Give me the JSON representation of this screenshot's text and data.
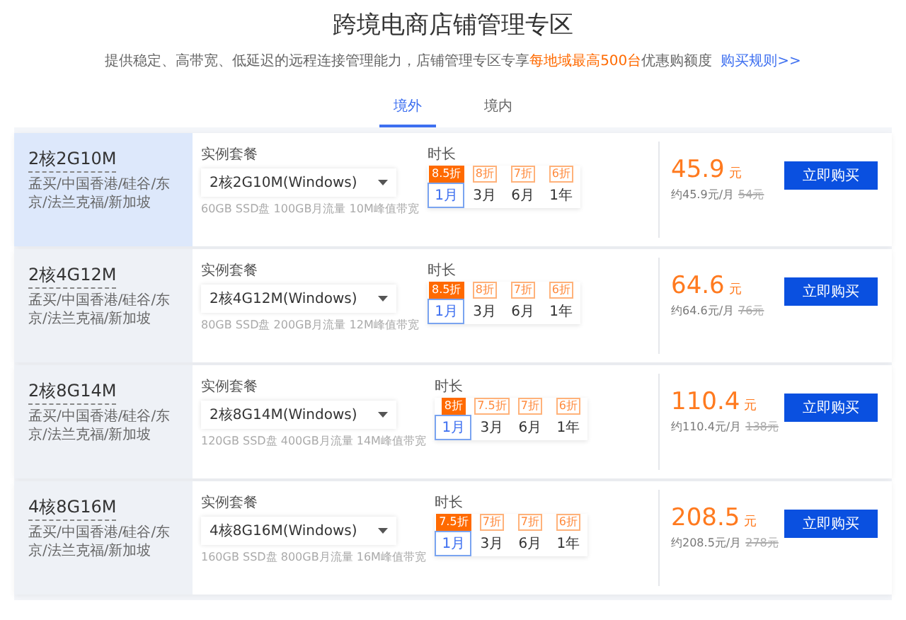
{
  "title": "跨境电商店铺管理专区",
  "intro": {
    "text": "提供稳定、高带宽、低延迟的远程连接管理能力，店铺管理专区专享",
    "highlight": "每地域最高500台",
    "text_after": "优惠购额度",
    "link": "购买规则>>"
  },
  "tabs": [
    {
      "label": "境外",
      "selected": true
    },
    {
      "label": "境内",
      "selected": false
    }
  ],
  "plans": [
    {
      "name": "2核2G10M",
      "regions": "孟买/中国香港/硅谷/东京/法兰克福/新加坡",
      "selected": true,
      "package_label": "实例套餐",
      "package_value": "2核2G10M(Windows)",
      "specs": "60GB SSD盘 100GB月流量 10M峰值带宽",
      "duration_label": "时长",
      "durations": [
        {
          "label": "1月",
          "discount": "8.5折",
          "selected": true
        },
        {
          "label": "3月",
          "discount": "8折",
          "selected": false
        },
        {
          "label": "6月",
          "discount": "7折",
          "selected": false
        },
        {
          "label": "1年",
          "discount": "6折",
          "selected": false
        }
      ],
      "price": "45.9",
      "currency": "元",
      "monthly": "约45.9元/月",
      "original": "54元",
      "buy": "立即购买"
    },
    {
      "name": "2核4G12M",
      "regions": "孟买/中国香港/硅谷/东京/法兰克福/新加坡",
      "selected": false,
      "package_label": "实例套餐",
      "package_value": "2核4G12M(Windows)",
      "specs": "80GB SSD盘 200GB月流量 12M峰值带宽",
      "duration_label": "时长",
      "durations": [
        {
          "label": "1月",
          "discount": "8.5折",
          "selected": true
        },
        {
          "label": "3月",
          "discount": "8折",
          "selected": false
        },
        {
          "label": "6月",
          "discount": "7折",
          "selected": false
        },
        {
          "label": "1年",
          "discount": "6折",
          "selected": false
        }
      ],
      "price": "64.6",
      "currency": "元",
      "monthly": "约64.6元/月",
      "original": "76元",
      "buy": "立即购买"
    },
    {
      "name": "2核8G14M",
      "regions": "孟买/中国香港/硅谷/东京/法兰克福/新加坡",
      "selected": false,
      "package_label": "实例套餐",
      "package_value": "2核8G14M(Windows)",
      "specs": "120GB SSD盘 400GB月流量 14M峰值带宽",
      "duration_label": "时长",
      "durations": [
        {
          "label": "1月",
          "discount": "8折",
          "selected": true
        },
        {
          "label": "3月",
          "discount": "7.5折",
          "selected": false
        },
        {
          "label": "6月",
          "discount": "7折",
          "selected": false
        },
        {
          "label": "1年",
          "discount": "6折",
          "selected": false
        }
      ],
      "price": "110.4",
      "currency": "元",
      "monthly": "约110.4元/月",
      "original": "138元",
      "buy": "立即购买"
    },
    {
      "name": "4核8G16M",
      "regions": "孟买/中国香港/硅谷/东京/法兰克福/新加坡",
      "selected": false,
      "package_label": "实例套餐",
      "package_value": "4核8G16M(Windows)",
      "specs": "160GB SSD盘 800GB月流量 16M峰值带宽",
      "duration_label": "时长",
      "durations": [
        {
          "label": "1月",
          "discount": "7.5折",
          "selected": true
        },
        {
          "label": "3月",
          "discount": "7折",
          "selected": false
        },
        {
          "label": "6月",
          "discount": "7折",
          "selected": false
        },
        {
          "label": "1年",
          "discount": "6折",
          "selected": false
        }
      ],
      "price": "208.5",
      "currency": "元",
      "monthly": "约208.5元/月",
      "original": "278元",
      "buy": "立即购买"
    }
  ]
}
